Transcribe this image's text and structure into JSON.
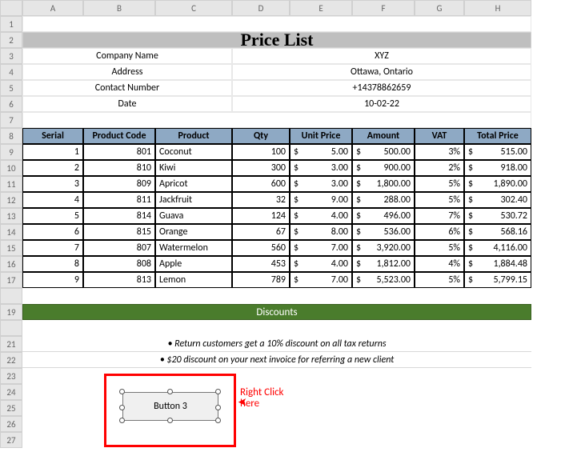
{
  "columns": [
    "",
    "A",
    "B",
    "C",
    "D",
    "E",
    "F",
    "G",
    "H"
  ],
  "row_nums": [
    "1",
    "2",
    "3",
    "4",
    "5",
    "6",
    "7",
    "8",
    "9",
    "10",
    "11",
    "12",
    "13",
    "14",
    "15",
    "16",
    "17",
    "",
    "19",
    "",
    "21",
    "22",
    "23",
    "24",
    "25",
    "26",
    "27"
  ],
  "title": "Price List",
  "info": {
    "labels": [
      "Company Name",
      "Address",
      "Contact Number",
      "Date"
    ],
    "values": [
      "XYZ",
      "Ottawa, Ontario",
      "+14378862659",
      "10-02-22"
    ]
  },
  "headers": [
    "Serial",
    "Product Code",
    "Product",
    "Qty",
    "Unit Price",
    "Amount",
    "VAT",
    "Total Price"
  ],
  "rows": [
    {
      "serial": "1",
      "code": "801",
      "product": "Coconut",
      "qty": "100",
      "unit": "5.00",
      "amount": "500.00",
      "vat": "3%",
      "total": "515.00"
    },
    {
      "serial": "2",
      "code": "810",
      "product": "Kiwi",
      "qty": "300",
      "unit": "3.00",
      "amount": "900.00",
      "vat": "2%",
      "total": "918.00"
    },
    {
      "serial": "3",
      "code": "809",
      "product": "Apricot",
      "qty": "600",
      "unit": "3.00",
      "amount": "1,800.00",
      "vat": "5%",
      "total": "1,890.00"
    },
    {
      "serial": "4",
      "code": "811",
      "product": "Jackfruit",
      "qty": "32",
      "unit": "9.00",
      "amount": "288.00",
      "vat": "5%",
      "total": "302.40"
    },
    {
      "serial": "5",
      "code": "814",
      "product": "Guava",
      "qty": "124",
      "unit": "4.00",
      "amount": "496.00",
      "vat": "7%",
      "total": "530.72"
    },
    {
      "serial": "6",
      "code": "815",
      "product": "Orange",
      "qty": "67",
      "unit": "8.00",
      "amount": "536.00",
      "vat": "6%",
      "total": "568.16"
    },
    {
      "serial": "7",
      "code": "807",
      "product": "Watermelon",
      "qty": "560",
      "unit": "7.00",
      "amount": "3,920.00",
      "vat": "5%",
      "total": "4,116.00"
    },
    {
      "serial": "8",
      "code": "808",
      "product": "Apple",
      "qty": "453",
      "unit": "4.00",
      "amount": "1,812.00",
      "vat": "4%",
      "total": "1,884.48"
    },
    {
      "serial": "9",
      "code": "813",
      "product": "Lemon",
      "qty": "789",
      "unit": "7.00",
      "amount": "5,523.00",
      "vat": "5%",
      "total": "5,799.15"
    }
  ],
  "discounts": {
    "header": "Discounts",
    "lines": [
      "• Return customers get a 10% discount on all tax returns",
      "• $20 discount on your next invoice for referring a new client"
    ]
  },
  "button_label": "Button 3",
  "annotation": "Right Click here",
  "cur": "$"
}
